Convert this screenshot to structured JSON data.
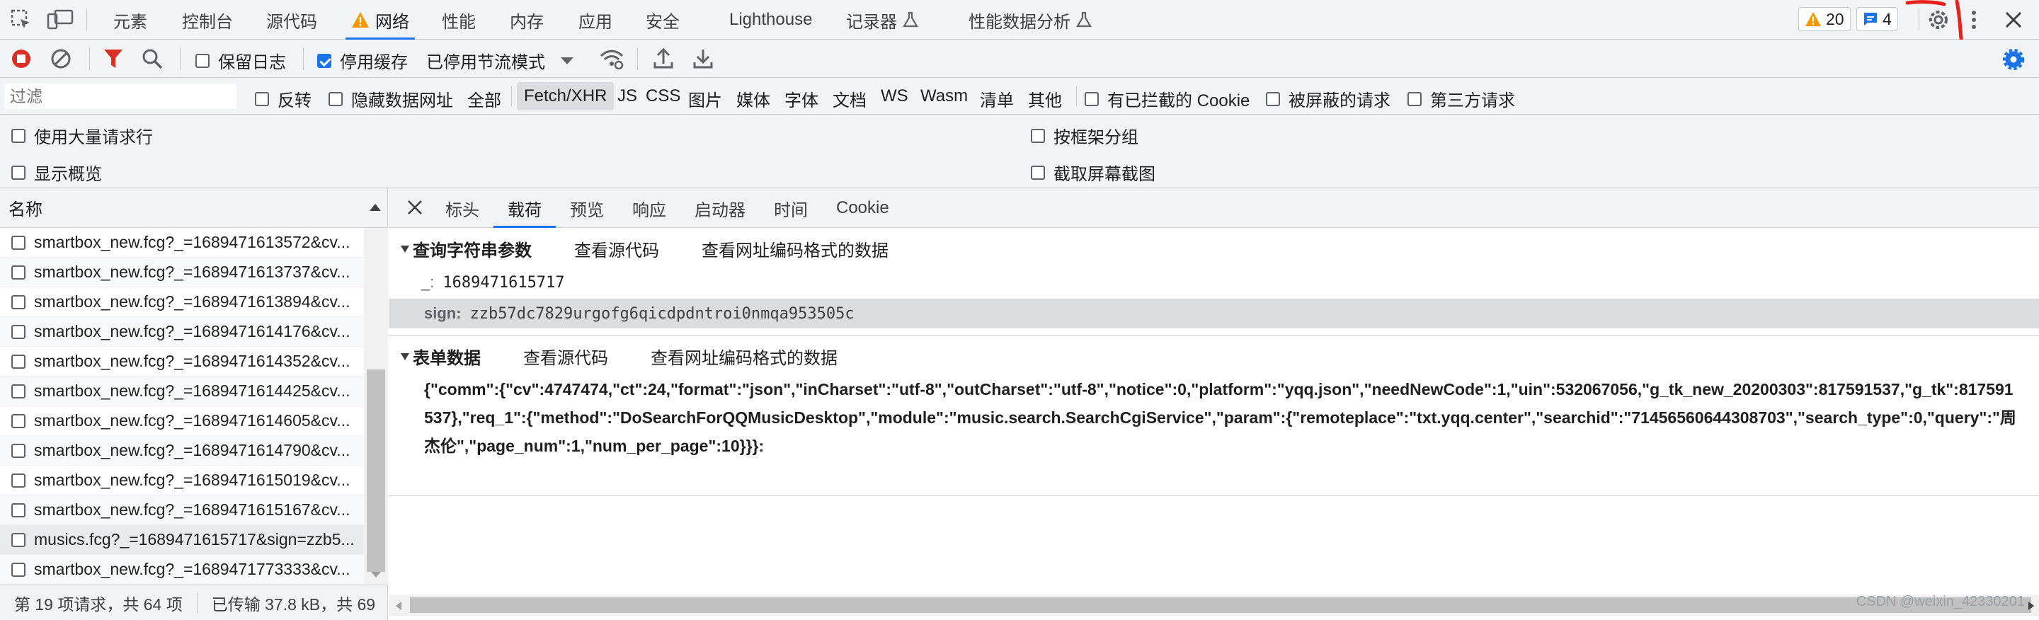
{
  "colors": {
    "accent": "#1a73e8",
    "record_red": "#d93025",
    "filter_red": "#d93025",
    "warning": "#f29900",
    "annotation_red": "#e8201b"
  },
  "tabs": [
    {
      "label": "元素"
    },
    {
      "label": "控制台"
    },
    {
      "label": "源代码"
    },
    {
      "label": "网络",
      "active": true,
      "icon": "warning-icon"
    },
    {
      "label": "性能"
    },
    {
      "label": "内存"
    },
    {
      "label": "应用"
    },
    {
      "label": "安全"
    },
    {
      "label": "Lighthouse"
    },
    {
      "label": "记录器",
      "icon": "flask-icon"
    },
    {
      "label": "性能数据分析",
      "icon": "flask-icon"
    }
  ],
  "badges": {
    "warnings": "20",
    "messages": "4"
  },
  "toolbar": {
    "preserve_log": "保留日志",
    "disable_cache": "停用缓存",
    "throttle": "已停用节流模式"
  },
  "filterbar": {
    "placeholder": "过滤",
    "invert": "反转",
    "hide_data_urls": "隐藏数据网址",
    "types": [
      "全部",
      "Fetch/XHR",
      "JS",
      "CSS",
      "图片",
      "媒体",
      "字体",
      "文档",
      "WS",
      "Wasm",
      "清单",
      "其他"
    ],
    "active_type": "Fetch/XHR",
    "blocked_cookies": "有已拦截的 Cookie",
    "blocked_requests": "被屏蔽的请求",
    "third_party": "第三方请求"
  },
  "options": {
    "big_rows": "使用大量请求行",
    "group_by_frame": "按框架分组",
    "overview": "显示概览",
    "screenshots": "截取屏幕截图"
  },
  "request_list": {
    "header": "名称",
    "rows": [
      "smartbox_new.fcg?_=1689471613572&cv...",
      "smartbox_new.fcg?_=1689471613737&cv...",
      "smartbox_new.fcg?_=1689471613894&cv...",
      "smartbox_new.fcg?_=1689471614176&cv...",
      "smartbox_new.fcg?_=1689471614352&cv...",
      "smartbox_new.fcg?_=1689471614425&cv...",
      "smartbox_new.fcg?_=1689471614605&cv...",
      "smartbox_new.fcg?_=1689471614790&cv...",
      "smartbox_new.fcg?_=1689471615019&cv...",
      "smartbox_new.fcg?_=1689471615167&cv...",
      "musics.fcg?_=1689471615717&sign=zzb5...",
      "smartbox_new.fcg?_=1689471773333&cv..."
    ],
    "selected_index": 10
  },
  "statusbar": {
    "requests": "第 19 项请求，共 64 项",
    "transferred": "已传输 37.8 kB，共 69"
  },
  "detail": {
    "tabs": [
      "标头",
      "载荷",
      "预览",
      "响应",
      "启动器",
      "时间",
      "Cookie"
    ],
    "active_tab": "载荷",
    "query_section": {
      "title": "查询字符串参数",
      "view_source": "查看源代码",
      "view_encoded": "查看网址编码格式的数据"
    },
    "query_params": [
      {
        "key": "_:",
        "value": "1689471615717"
      },
      {
        "key": "sign:",
        "value": "zzb57dc7829urgofg6qicdpdntroi0nmqa953505c"
      }
    ],
    "form_section": {
      "title": "表单数据",
      "view_source": "查看源代码",
      "view_encoded": "查看网址编码格式的数据"
    },
    "form_data": "{\"comm\":{\"cv\":4747474,\"ct\":24,\"format\":\"json\",\"inCharset\":\"utf-8\",\"outCharset\":\"utf-8\",\"notice\":0,\"platform\":\"yqq.json\",\"needNewCode\":1,\"uin\":532067056,\"g_tk_new_20200303\":817591537,\"g_tk\":817591537},\"req_1\":{\"method\":\"DoSearchForQQMusicDesktop\",\"module\":\"music.search.SearchCgiService\",\"param\":{\"remoteplace\":\"txt.yqq.center\",\"searchid\":\"71456560644308703\",\"search_type\":0,\"query\":\"周杰伦\",\"page_num\":1,\"num_per_page\":10}}}:"
  },
  "watermark": "CSDN @weixin_42330201"
}
